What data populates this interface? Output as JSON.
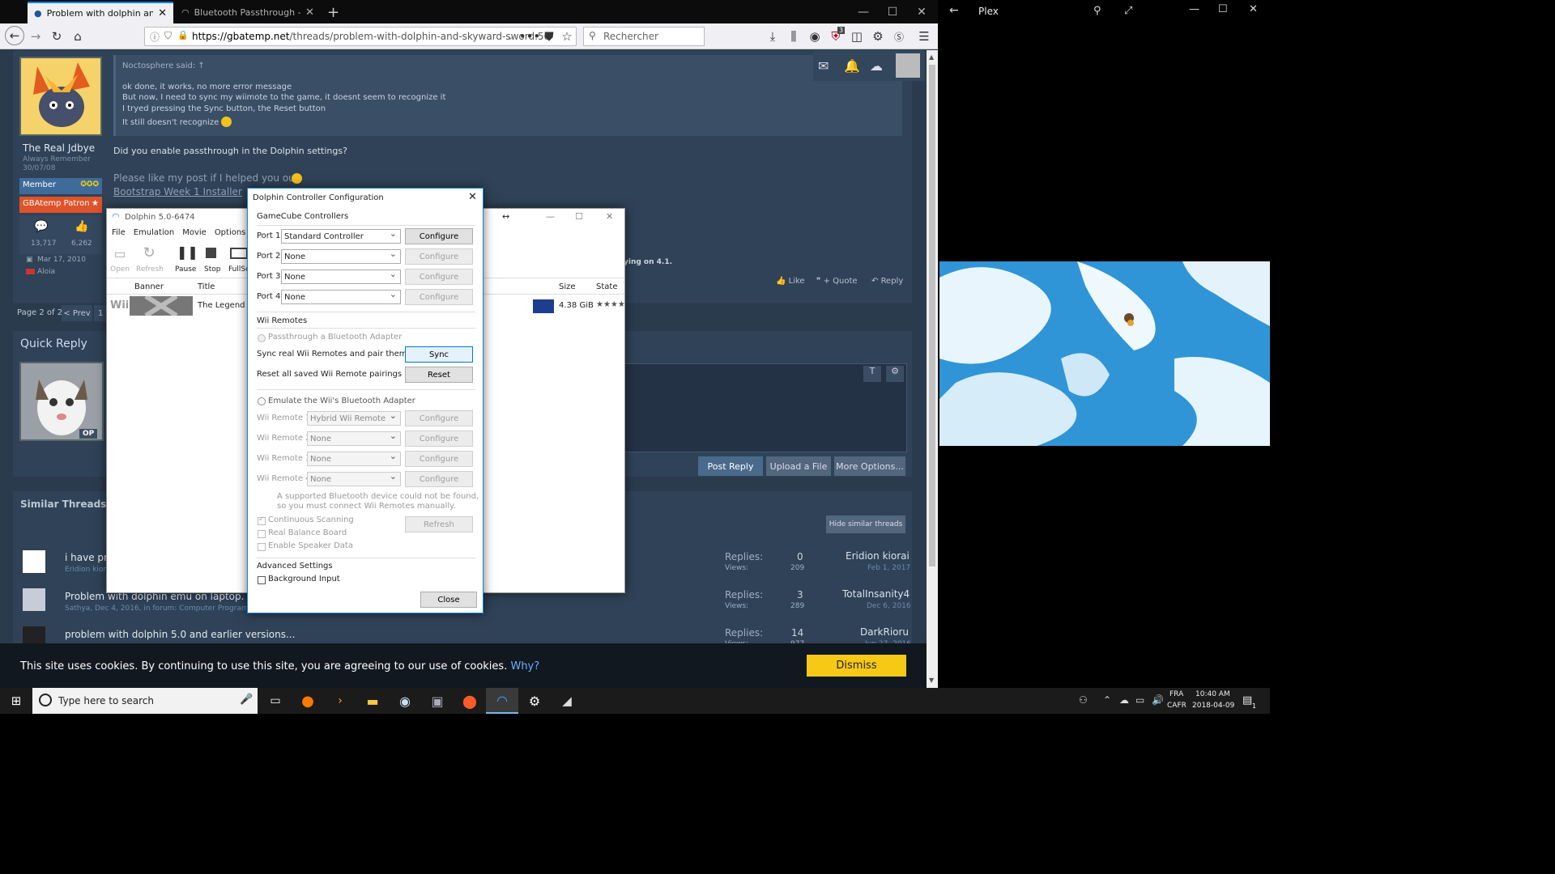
{
  "browser": {
    "tabs": [
      {
        "title": "Problem with dolphin and Skyw"
      },
      {
        "title": "Bluetooth Passthrough - Dolph"
      }
    ],
    "url_domain": "https://gbatemp.net",
    "url_path": "/threads/problem-with-dolphin-and-skyward-sword.50",
    "search_placeholder": "Rechercher",
    "notif_count": "3"
  },
  "forum": {
    "quote_header": "Noctosphere said: ↑",
    "quote_lines": [
      "ok done, it works, no more error message",
      "But now, I need to sync my wiimote to the game, it doesnt seem to recognize it",
      "I tryed pressing the Sync button, the Reset button",
      "It still doesn't recognize it"
    ],
    "reply_text": "Did you enable passthrough in the Dolphin settings?",
    "signature": "Please like my post if I helped you out",
    "sig_link": "Bootstrap Week 1 Installer",
    "user": {
      "name": "The Real Jdbye",
      "subtitle": "Always Remember",
      "date": "30/07/08",
      "rank": "Member",
      "patron": "GBAtemp Patron",
      "messages": "13,717",
      "likes": "6,262",
      "joined": "Mar 17, 2010",
      "location": "Aloia"
    },
    "post_tail": "ying on 4.1.",
    "actions": {
      "like": "Like",
      "quote": "+ Quote",
      "reply": "Reply"
    },
    "pager": {
      "label": "Page 2 of 2",
      "prev": "< Prev",
      "num": "1"
    },
    "quick_reply": "Quick Reply",
    "op_badge": "OP",
    "buttons": {
      "post_reply": "Post Reply",
      "upload": "Upload a File",
      "more": "More Options..."
    },
    "similar_title": "Similar Threads - I",
    "hide_similar": "Hide similar threads",
    "threads": [
      {
        "title": "i have pro",
        "meta": "Eridion kiora",
        "replies_label": "Replies:",
        "replies": "0",
        "views_label": "Views:",
        "views": "209",
        "last_user": "Eridion kiorai",
        "last_date": "Feb 1, 2017"
      },
      {
        "title": "Problem with dolphin emu on laptop.",
        "meta": "Sathya, Dec 4, 2016, in forum: Computer Programmin",
        "replies_label": "Replies:",
        "replies": "3",
        "views_label": "Views:",
        "views": "289",
        "last_user": "TotalInsanity4",
        "last_date": "Dec 6, 2016"
      },
      {
        "title": "problem with dolphin 5.0 and earlier versions...",
        "meta": "",
        "replies_label": "Replies:",
        "replies": "14",
        "views_label": "Views:",
        "views": "977",
        "last_user": "DarkRioru",
        "last_date": "Jun 27, 2016"
      }
    ],
    "cookie_text": "This site uses cookies. By continuing to use this site, you are agreeing to our use of cookies.",
    "cookie_why": "Why?",
    "cookie_dismiss": "Dismiss"
  },
  "dolphin": {
    "title": "Dolphin 5.0-6474",
    "menu": [
      "File",
      "Emulation",
      "Movie",
      "Options"
    ],
    "toolbar": [
      "Open",
      "Refresh",
      "Pause",
      "Stop",
      "FullSc"
    ],
    "columns": {
      "banner": "Banner",
      "title": "Title",
      "size": "Size",
      "state": "State"
    },
    "game": {
      "platform": "Wii",
      "title": "The Legend of",
      "size": "4.38 GiB",
      "state": "★★★★"
    }
  },
  "controller_dialog": {
    "title": "Dolphin Controller Configuration",
    "gc_header": "GameCube Controllers",
    "ports": [
      {
        "label": "Port 1",
        "value": "Standard Controller",
        "btn": "Configure"
      },
      {
        "label": "Port 2",
        "value": "None",
        "btn": "Configure"
      },
      {
        "label": "Port 3",
        "value": "None",
        "btn": "Configure"
      },
      {
        "label": "Port 4",
        "value": "None",
        "btn": "Configure"
      }
    ],
    "wii_header": "Wii Remotes",
    "passthrough": "Passthrough a Bluetooth Adapter",
    "sync_label": "Sync real Wii Remotes and pair them",
    "sync_btn": "Sync",
    "reset_label": "Reset all saved Wii Remote pairings",
    "reset_btn": "Reset",
    "emulate": "Emulate the Wii's Bluetooth Adapter",
    "remotes": [
      {
        "label": "Wii Remote 1",
        "value": "Hybrid Wii Remote",
        "btn": "Configure"
      },
      {
        "label": "Wii Remote 2",
        "value": "None",
        "btn": "Configure"
      },
      {
        "label": "Wii Remote 3",
        "value": "None",
        "btn": "Configure"
      },
      {
        "label": "Wii Remote 4",
        "value": "None",
        "btn": "Configure"
      }
    ],
    "bt_note_1": "A supported Bluetooth device could not be found,",
    "bt_note_2": "so you must connect Wii Remotes manually.",
    "continuous": "Continuous Scanning",
    "refresh_btn": "Refresh",
    "balance": "Real Balance Board",
    "speaker": "Enable Speaker Data",
    "advanced": "Advanced Settings",
    "background": "Background Input",
    "close_btn": "Close"
  },
  "plex": {
    "title": "Plex"
  },
  "taskbar": {
    "search_placeholder": "Type here to search",
    "lang1": "FRA",
    "lang2": "CAFR",
    "time": "10:40 AM",
    "date": "2018-04-09",
    "notif": "1"
  }
}
